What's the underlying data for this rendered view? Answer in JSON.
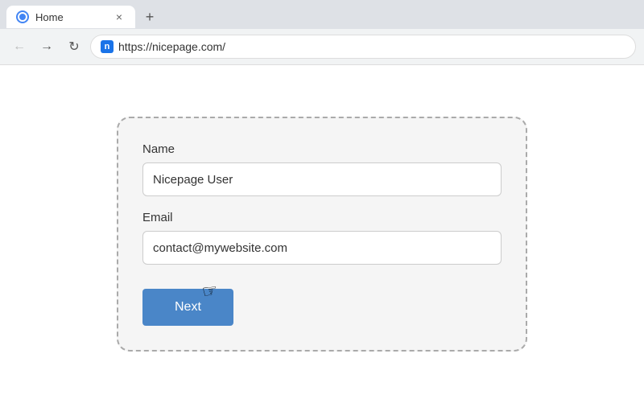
{
  "browser": {
    "tab": {
      "label": "Home",
      "close_icon": "×",
      "new_tab_icon": "+"
    },
    "nav": {
      "back_icon": "←",
      "forward_icon": "→",
      "refresh_icon": "↻",
      "url": "https://nicepage.com/"
    }
  },
  "form": {
    "name_label": "Name",
    "name_value": "Nicepage User",
    "name_placeholder": "Nicepage User",
    "email_label": "Email",
    "email_value": "contact@mywebsite.com",
    "email_placeholder": "contact@mywebsite.com",
    "next_button_label": "Next"
  }
}
